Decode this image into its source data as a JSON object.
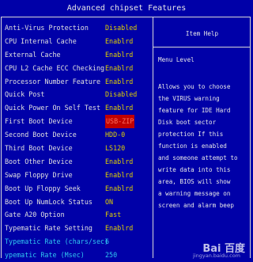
{
  "title": "Advanced chipset Features",
  "settings": [
    {
      "label": "Anti-Virus Protection",
      "value": "Disabled"
    },
    {
      "label": "CPU Internal Cache",
      "value": "Enablrd"
    },
    {
      "label": "External Cache",
      "value": "Enablrd"
    },
    {
      "label": "CPU L2 Cache ECC Checking",
      "value": "Enablrd"
    },
    {
      "label": "Processor Number Feature",
      "value": "Enablrd"
    },
    {
      "label": "Quick Post",
      "value": "Disabled"
    },
    {
      "label": "Quick Power On Self Test",
      "value": "Enablrd"
    },
    {
      "label": "First Boot Device",
      "value": "USB-ZIP"
    },
    {
      "label": "Second Boot Device",
      "value": "HDD-0"
    },
    {
      "label": "Third Boot Device",
      "value": "LS120"
    },
    {
      "label": "Boot Other Device",
      "value": "Enablrd"
    },
    {
      "label": "Swap Floppy Drive",
      "value": "Enablrd"
    },
    {
      "label": "Boot Up Floppy Seek",
      "value": "Enablrd"
    },
    {
      "label": "Boot Up NumLock Status",
      "value": "ON"
    },
    {
      "label": "Gate A20 Option",
      "value": "Fast"
    },
    {
      "label": "Typematic Rate Setting",
      "value": "Enablrd"
    },
    {
      "label": "Typematic Rate (chars/sec)",
      "value": "6"
    },
    {
      "label": "ypematic Rate (Msec)",
      "value": "250"
    }
  ],
  "help": {
    "header": "Item  Help",
    "menu_level": "Menu   Level",
    "lines": [
      "Allows you to choose",
      "the VIRUS warning",
      "feature for IDE Hard",
      "Disk boot sector",
      "protection If this",
      "function is enabled",
      "and someone attempt to",
      "write data into this",
      "area, BIOS will show",
      "a warning message on",
      "screen and alarm beep"
    ]
  },
  "watermark": {
    "brand": "Bai 百度",
    "site": "jingyan.baidu.com"
  },
  "colors": {
    "background": "#0000a8",
    "value": "#e0d000",
    "highlight": "#30c8f0",
    "selected": "#c00000"
  }
}
